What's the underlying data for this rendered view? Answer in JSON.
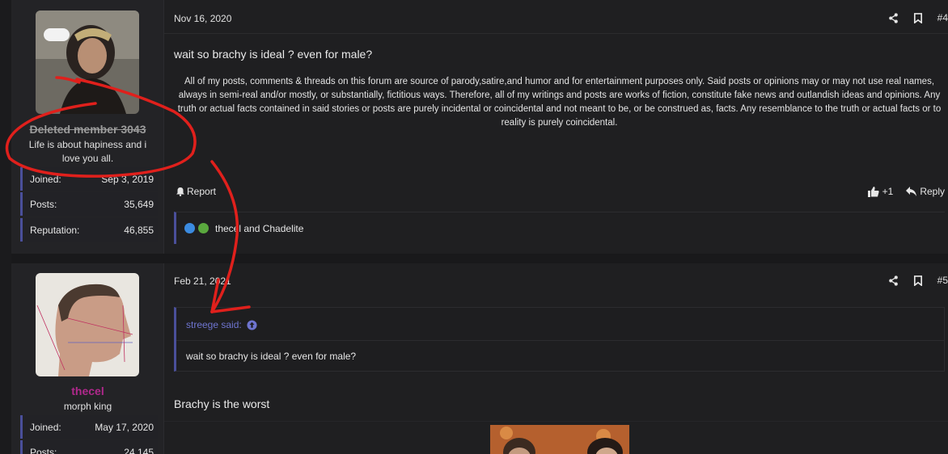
{
  "posts": [
    {
      "user": {
        "name": "Deleted member 3043",
        "title": "Life is about hapiness and i love you all.",
        "stats": [
          {
            "label": "Joined:",
            "value": "Sep 3, 2019"
          },
          {
            "label": "Posts:",
            "value": "35,649"
          },
          {
            "label": "Reputation:",
            "value": "46,855"
          }
        ]
      },
      "date": "Nov 16, 2020",
      "number": "#4",
      "title": "wait so brachy is ideal ? even for male?",
      "signature": "All of my posts, comments & threads on this forum are source of parody,satire,and humor and for entertainment purposes only. Said posts or opinions may or may not use real names, always in semi-real and/or mostly, or substantially, fictitious ways. Therefore, all of my writings and posts are works of fiction, constitute fake news and outlandish ideas and opinions. Any truth or actual facts contained in said stories or posts are purely incidental or coincidental and not meant to be, or be construed as, facts. Any resemblance to the truth or actual facts or to reality is purely coincidental.",
      "report_label": "Report",
      "like_label": "+1",
      "reply_label": "Reply",
      "reactions_text": "thecel and Chadelite"
    },
    {
      "user": {
        "name": "thecel",
        "title": "morph king",
        "stats": [
          {
            "label": "Joined:",
            "value": "May 17, 2020"
          },
          {
            "label": "Posts:",
            "value": "24,145"
          }
        ]
      },
      "date": "Feb 21, 2021",
      "number": "#5",
      "quote_author": "streege said:",
      "quote_text": "wait so brachy is ideal ? even for male?",
      "body": "Brachy is the worst"
    }
  ],
  "colors": {
    "accent": "#4a4f9a",
    "deleted_name": "#9b9b9b",
    "thecel_name": "#b0288c",
    "annotation_red": "#e0201c",
    "quote_link": "#6e74cf"
  },
  "icons": [
    "share-icon",
    "bookmark-icon",
    "bell-icon",
    "thumbs-up-icon",
    "reply-icon",
    "arrow-up-circle-icon"
  ]
}
